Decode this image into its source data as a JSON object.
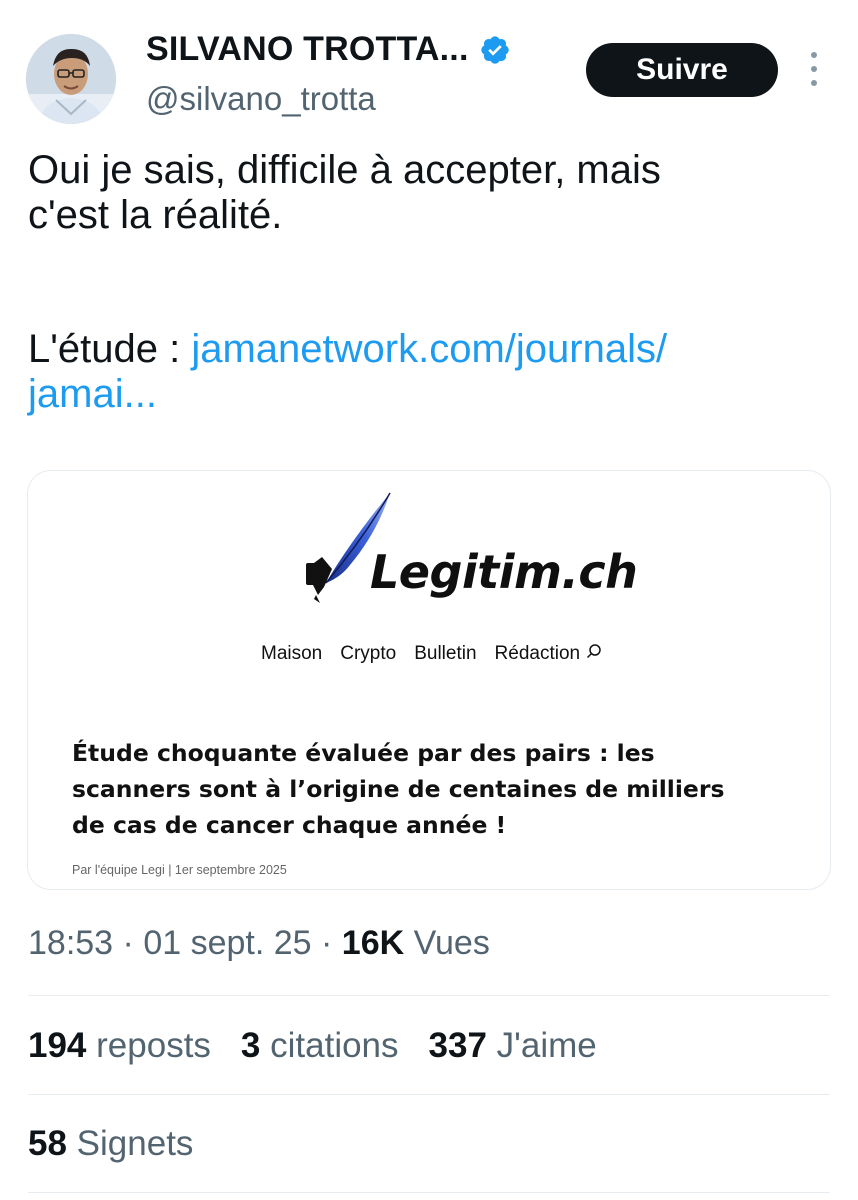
{
  "author": {
    "name": "SILVANO TROTTA...",
    "handle": "@silvano_trotta",
    "follow_label": "Suivre"
  },
  "tweet": {
    "line1": "Oui je sais, difficile à accepter, mais",
    "line2": "c'est la réalité.",
    "study_prefix": "L'étude : ",
    "link_line1": "jamanetwork.com/journals/",
    "link_line2": "jamai..."
  },
  "card": {
    "logo_text": "Legitim.ch",
    "nav": [
      "Maison",
      "Crypto",
      "Bulletin",
      "Rédaction"
    ],
    "headline_line1": "Étude choquante évaluée par des pairs : les",
    "headline_line2": "scanners sont à l’origine de centaines de milliers",
    "headline_line3": "de cas de cancer chaque année !",
    "byline": "Par l'équipe Legi | 1er septembre 2025"
  },
  "meta": {
    "time": "18:53",
    "date": "01 sept. 25",
    "views_count": "16K",
    "views_label": "Vues"
  },
  "stats": {
    "reposts_count": "194",
    "reposts_label": "reposts",
    "citations_count": "3",
    "citations_label": "citations",
    "likes_count": "337",
    "likes_label": "J'aime",
    "bookmarks_count": "58",
    "bookmarks_label": "Signets"
  },
  "colors": {
    "link": "#1d9bf0",
    "secondary_text": "#536471",
    "verified": "#1d9bf0",
    "button_bg": "#0f1419"
  },
  "icons": {
    "verified": "verified-badge-icon",
    "more": "more-vertical-icon",
    "search": "search-icon",
    "quill": "quill-pen-icon"
  }
}
